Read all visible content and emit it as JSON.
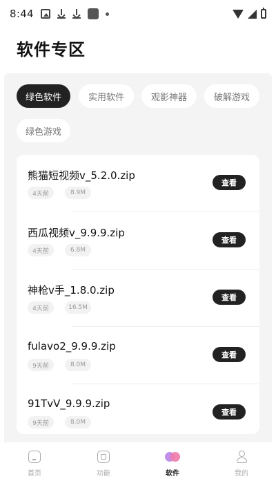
{
  "status_bar": {
    "time": "8:44",
    "icons": [
      "image-icon",
      "download-icon",
      "download-icon",
      "app-icon",
      "dot-icon",
      "wifi-icon",
      "signal-icon",
      "battery-icon"
    ]
  },
  "page": {
    "title": "软件专区"
  },
  "tabs": [
    {
      "label": "绿色软件",
      "active": true
    },
    {
      "label": "实用软件",
      "active": false
    },
    {
      "label": "观影神器",
      "active": false
    },
    {
      "label": "破解游戏",
      "active": false
    },
    {
      "label": "绿色游戏",
      "active": false
    }
  ],
  "items": [
    {
      "name": "熊猫短视频v_5.2.0.zip",
      "age": "4天前",
      "size": "8.9M",
      "action": "查看"
    },
    {
      "name": "西瓜视频v_9.9.9.zip",
      "age": "4天前",
      "size": "6.8M",
      "action": "查看"
    },
    {
      "name": "神枪v手_1.8.0.zip",
      "age": "4天前",
      "size": "16.5M",
      "action": "查看"
    },
    {
      "name": "fulavo2_9.9.9.zip",
      "age": "9天前",
      "size": "8.0M",
      "action": "查看"
    },
    {
      "name": "91TvV_9.9.9.zip",
      "age": "9天前",
      "size": "8.0M",
      "action": "查看"
    }
  ],
  "bottom_nav": [
    {
      "label": "首页",
      "icon": "home-icon",
      "active": false
    },
    {
      "label": "功能",
      "icon": "function-icon",
      "active": false
    },
    {
      "label": "软件",
      "icon": "software-icon",
      "active": true
    },
    {
      "label": "我的",
      "icon": "profile-icon",
      "active": false
    }
  ],
  "colors": {
    "accent": "#222222",
    "background": "#f4f4f4",
    "nav_active_icon_1": "#c08ee8",
    "nav_active_icon_2": "#f07aa8"
  }
}
